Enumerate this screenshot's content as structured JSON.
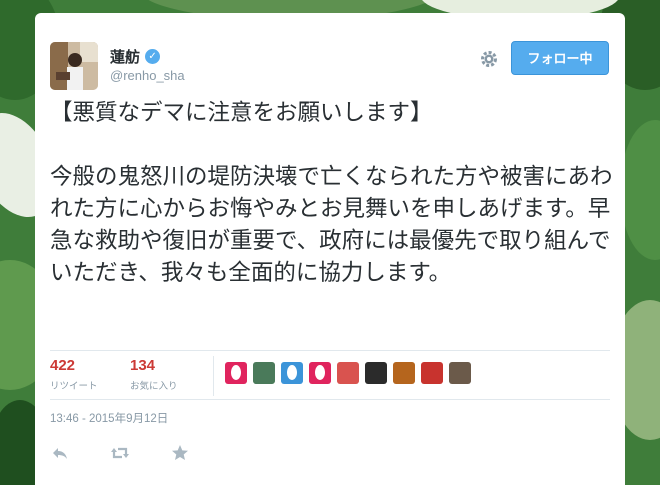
{
  "user": {
    "display_name": "蓮舫",
    "handle": "@renho_sha",
    "verified_icon": "verified-badge-icon"
  },
  "header": {
    "follow_label": "フォロー中",
    "settings_icon": "gear-icon"
  },
  "tweet": {
    "text": "【悪質なデマに注意をお願いします】\n\n今般の鬼怒川の堤防決壊で亡くなられた方や被害にあわれた方に心からお悔やみとお見舞いを申しあげます。早急な救助や復旧が重要で、政府には最優先で取り組んでいただき、我々も全面的に協力します。"
  },
  "stats": {
    "retweets_count": "422",
    "retweets_label": "リツイート",
    "favorites_count": "134",
    "favorites_label": "お気に入り"
  },
  "engagers": [
    {
      "kind": "egg",
      "color": "#e0245e"
    },
    {
      "kind": "photo",
      "color": "#4a7a5a"
    },
    {
      "kind": "egg",
      "color": "#3b94d9"
    },
    {
      "kind": "egg",
      "color": "#e0245e"
    },
    {
      "kind": "photo",
      "color": "#d9534f"
    },
    {
      "kind": "photo",
      "color": "#2b2b2b"
    },
    {
      "kind": "photo",
      "color": "#b5651d"
    },
    {
      "kind": "photo",
      "color": "#c8332e"
    },
    {
      "kind": "photo",
      "color": "#6b5a4a"
    }
  ],
  "timestamp": "13:46 - 2015年9月12日",
  "actions": [
    "reply-icon",
    "retweet-icon",
    "favorite-icon"
  ],
  "colors": {
    "accent": "#55acee",
    "stat_number": "#cc3a36",
    "text": "#292f33",
    "muted": "#8899a6"
  }
}
